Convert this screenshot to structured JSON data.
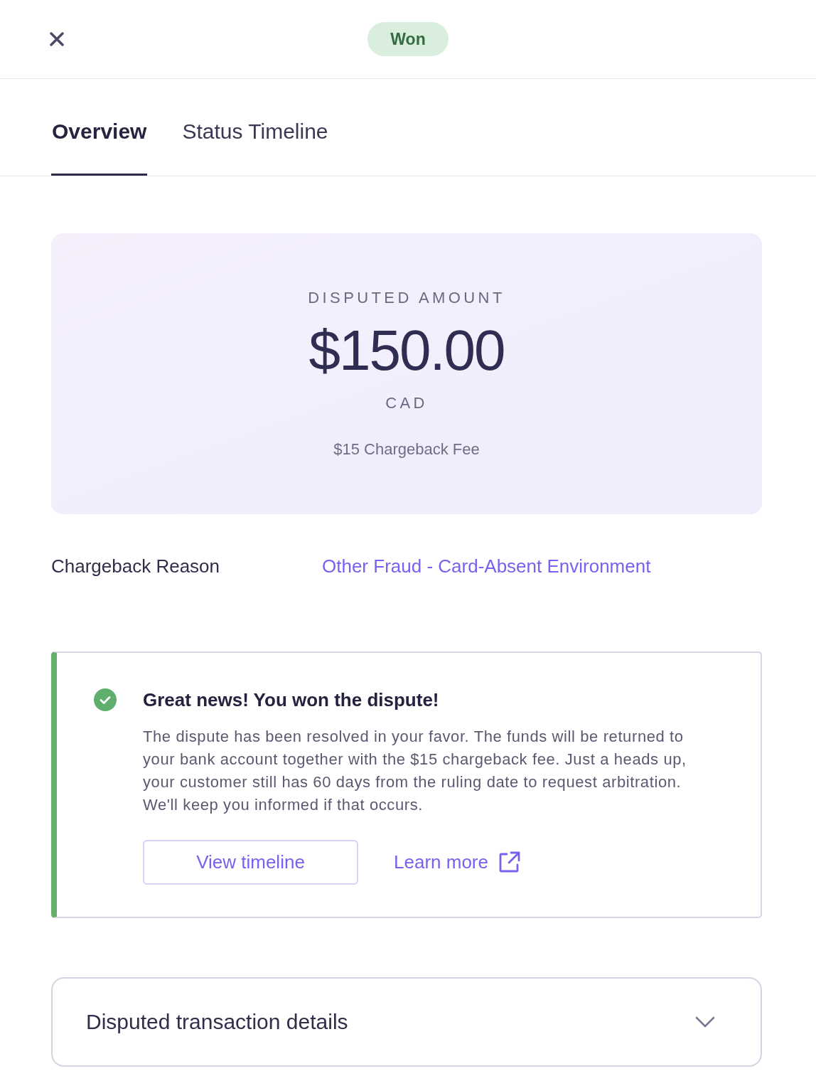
{
  "header": {
    "status": {
      "label": "Won",
      "kind": "won"
    }
  },
  "tabs": [
    {
      "label": "Overview",
      "selected": true
    },
    {
      "label": "Status Timeline",
      "selected": false
    }
  ],
  "amount_card": {
    "label": "DISPUTED AMOUNT",
    "amount": "$150.00",
    "currency": "CAD",
    "fee": "$15 Chargeback Fee"
  },
  "chargeback_reason": {
    "label": "Chargeback Reason",
    "value": "Other Fraud - Card-Absent Environment"
  },
  "alert": {
    "kind": "success",
    "title": "Great news! You won the dispute!",
    "body": "The dispute has been resolved in your favor. The funds will be returned to your bank account together with the $15 chargeback fee. Just a heads up, your customer still has 60 days from the ruling date to request arbitration. We'll keep you informed if that occurs.",
    "actions": [
      {
        "label": "View timeline",
        "kind": "button"
      },
      {
        "label": "Learn more",
        "kind": "external_link"
      }
    ]
  },
  "accordion": {
    "title": "Disputed transaction details",
    "expanded": false
  }
}
